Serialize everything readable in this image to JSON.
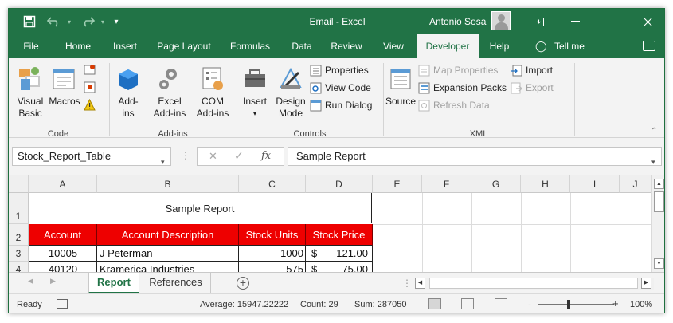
{
  "titlebar": {
    "title": "Email  -  Excel",
    "user": "Antonio Sosa",
    "qat": {
      "save": "save-icon",
      "undo": "undo-icon",
      "redo": "redo-icon",
      "customize": "customize-icon"
    },
    "controls": {
      "ribbon_display": "ribbon-display-icon",
      "minimize": "minimize-icon",
      "restore": "restore-icon",
      "close": "close-icon"
    }
  },
  "menu": {
    "tabs": [
      "File",
      "Home",
      "Insert",
      "Page Layout",
      "Formulas",
      "Data",
      "Review",
      "View",
      "Developer",
      "Help"
    ],
    "active_tab": "Developer",
    "tell_me": "Tell me"
  },
  "ribbon": {
    "code": {
      "label": "Code",
      "visual_basic": "Visual\nBasic",
      "macros": "Macros"
    },
    "addins": {
      "label": "Add-ins",
      "addins": "Add-\nins",
      "excel_addins": "Excel\nAdd-ins",
      "com_addins": "COM\nAdd-ins"
    },
    "controls": {
      "label": "Controls",
      "insert": "Insert",
      "design_mode": "Design\nMode",
      "properties": "Properties",
      "view_code": "View Code",
      "run_dialog": "Run Dialog"
    },
    "xml": {
      "label": "XML",
      "source": "Source",
      "map_properties": "Map Properties",
      "expansion_packs": "Expansion Packs",
      "refresh_data": "Refresh Data",
      "import": "Import",
      "export": "Export"
    }
  },
  "formula_bar": {
    "name_box": "Stock_Report_Table",
    "formula": "Sample Report"
  },
  "sheet": {
    "columns": [
      "A",
      "B",
      "C",
      "D",
      "E",
      "F",
      "G",
      "H",
      "I",
      "J"
    ],
    "rows": [
      "1",
      "2",
      "3",
      "4"
    ],
    "title": "Sample Report",
    "headers": [
      "Account",
      "Account Description",
      "Stock Units",
      "Stock Price"
    ],
    "data": [
      {
        "account": "10005",
        "description": "J Peterman",
        "units": "1000",
        "currency": "$",
        "price": "121.00"
      },
      {
        "account": "40120",
        "description": "Kramerica Industries",
        "units": "575",
        "currency": "$",
        "price": "75.00"
      }
    ],
    "header_color": "#ee0000"
  },
  "tabs": {
    "sheets": [
      "Report",
      "References"
    ],
    "active": "Report"
  },
  "status": {
    "ready": "Ready",
    "average": "Average: 15947.22222",
    "count": "Count: 29",
    "sum": "Sum: 287050",
    "zoom": "100%",
    "zoom_minus": "-",
    "zoom_plus": "+"
  },
  "colors": {
    "accent": "#217346"
  }
}
